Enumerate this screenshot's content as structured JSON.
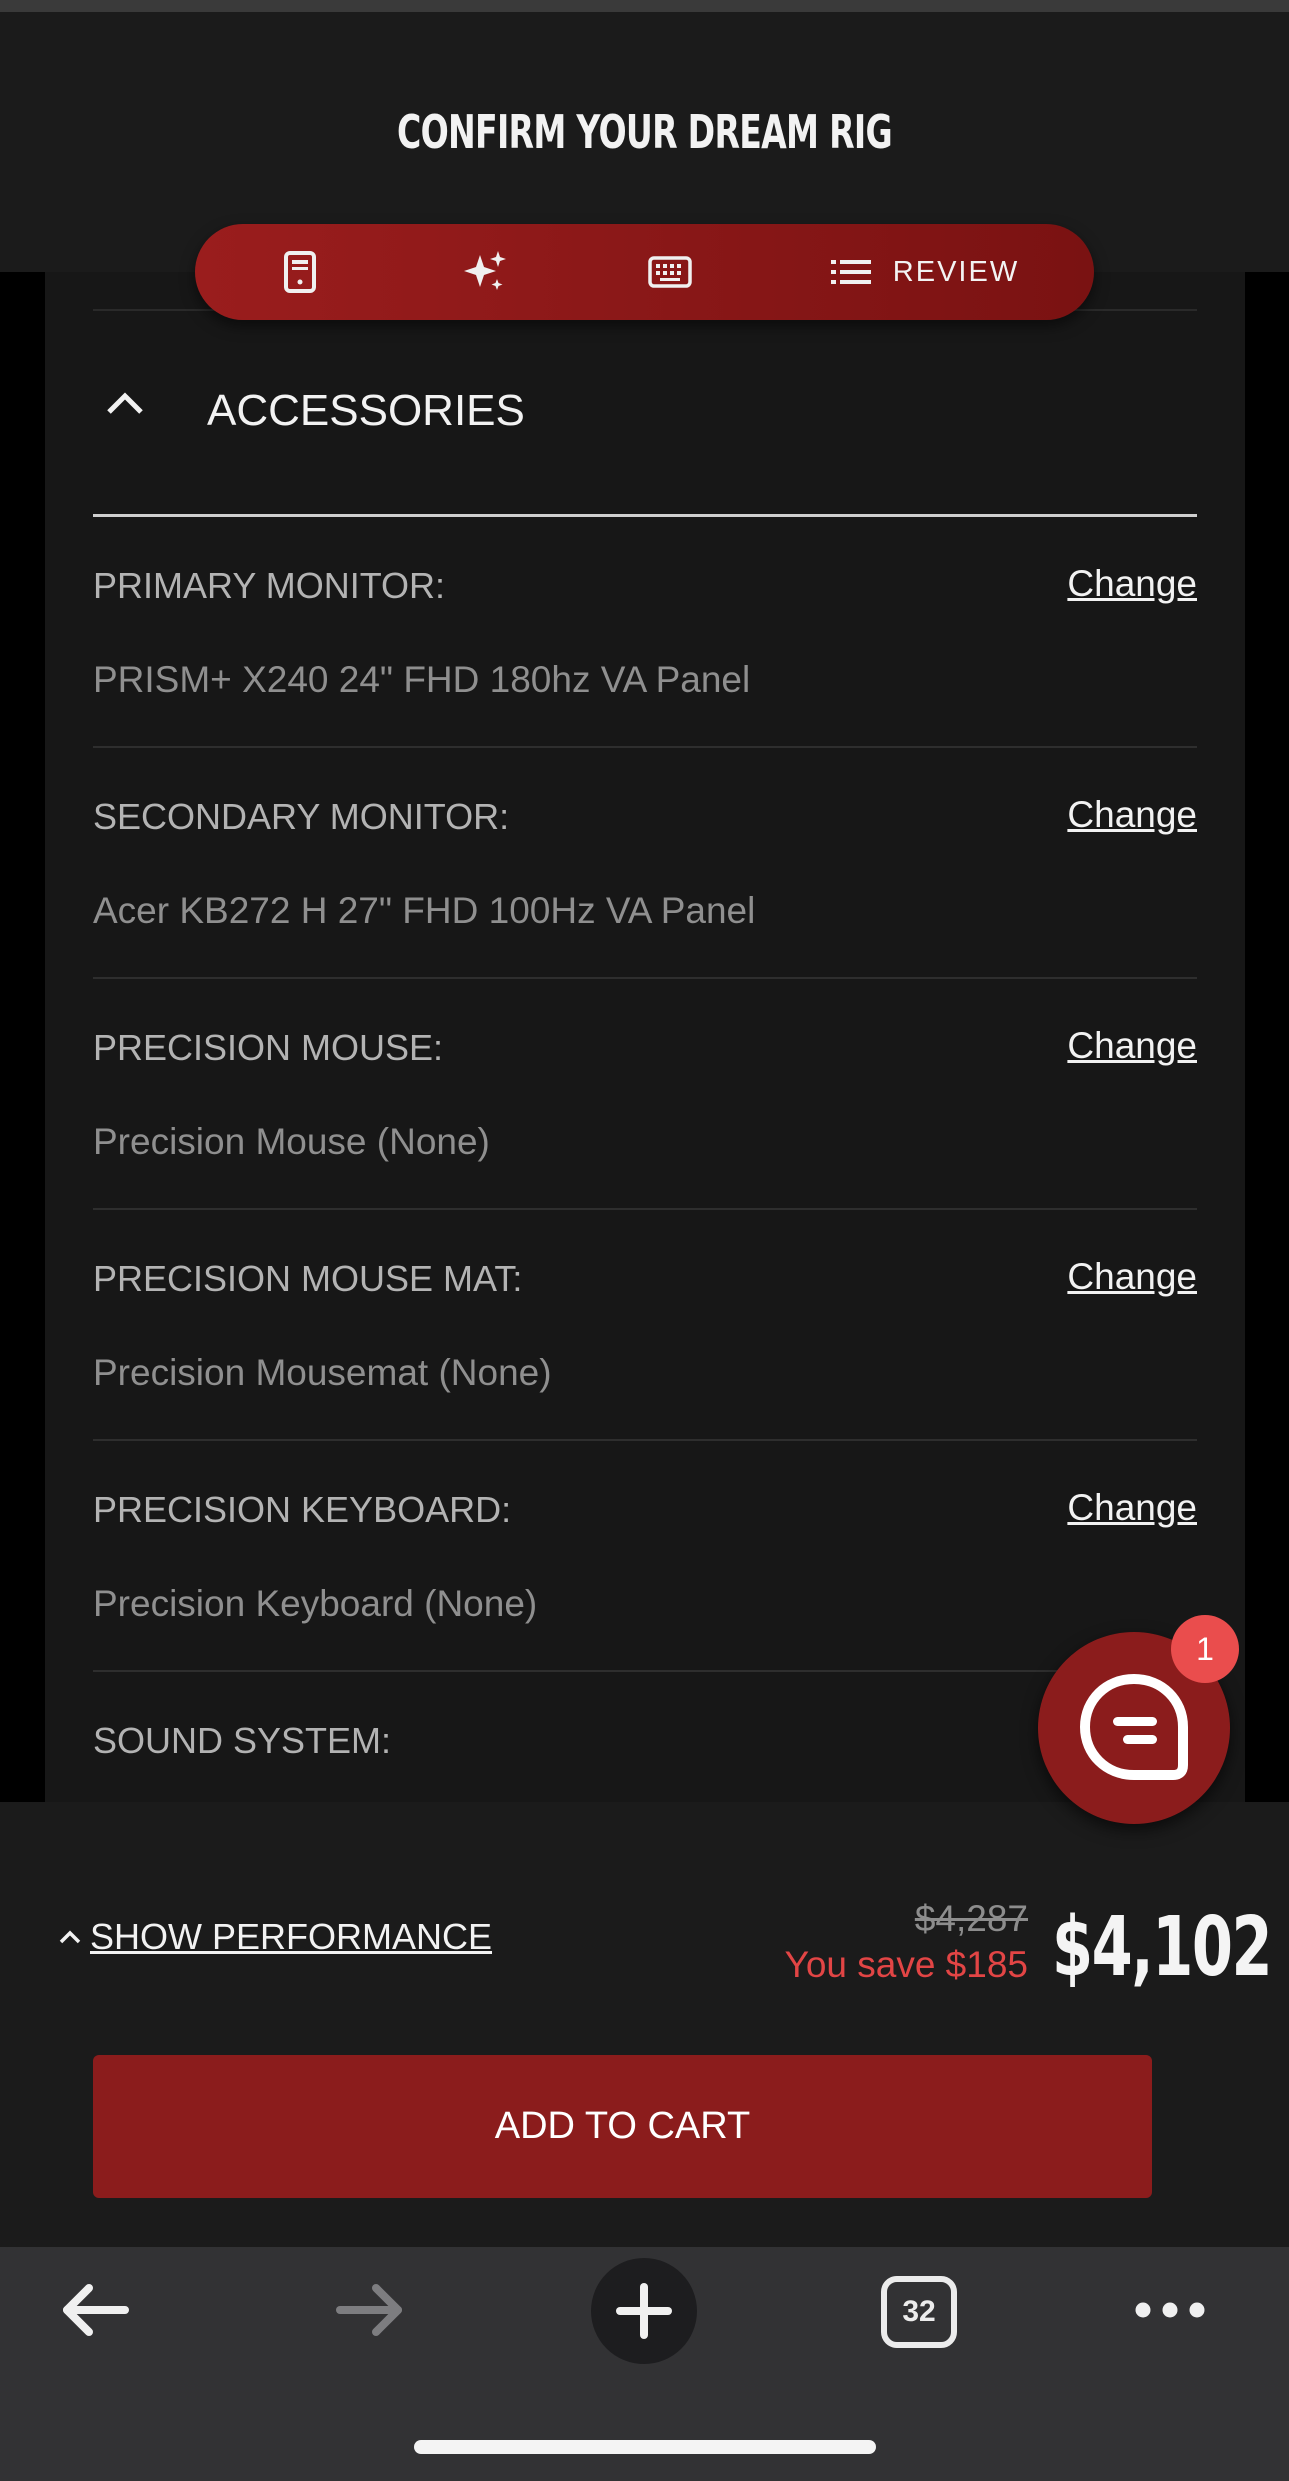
{
  "header": {
    "title": "CONFIRM YOUR DREAM RIG"
  },
  "steps": [
    {
      "icon": "pc-case-icon"
    },
    {
      "icon": "sparkle-icon"
    },
    {
      "icon": "keyboard-icon"
    },
    {
      "icon": "list-icon",
      "label": "REVIEW",
      "active": true
    }
  ],
  "section": {
    "title": "ACCESSORIES",
    "expanded": true
  },
  "items": [
    {
      "label": "PRIMARY MONITOR:",
      "value": "PRISM+ X240 24\" FHD 180hz VA Panel",
      "action": "Change"
    },
    {
      "label": "SECONDARY MONITOR:",
      "value": "Acer KB272 H 27\" FHD 100Hz VA Panel",
      "action": "Change"
    },
    {
      "label": "PRECISION MOUSE:",
      "value": "Precision Mouse (None)",
      "action": "Change"
    },
    {
      "label": "PRECISION MOUSE MAT:",
      "value": "Precision Mousemat (None)",
      "action": "Change"
    },
    {
      "label": "PRECISION KEYBOARD:",
      "value": "Precision Keyboard (None)",
      "action": "Change"
    },
    {
      "label": "SOUND SYSTEM:"
    }
  ],
  "chat": {
    "badge": "1"
  },
  "footer": {
    "performance_label": "SHOW PERFORMANCE",
    "original_price": "$4,287",
    "savings": "You save $185",
    "total": "$4,102",
    "add_to_cart": "ADD TO CART"
  },
  "browser": {
    "tab_count": "32"
  },
  "colors": {
    "accent": "#8b1c1c",
    "savings": "#e24545",
    "background": "#171717"
  }
}
